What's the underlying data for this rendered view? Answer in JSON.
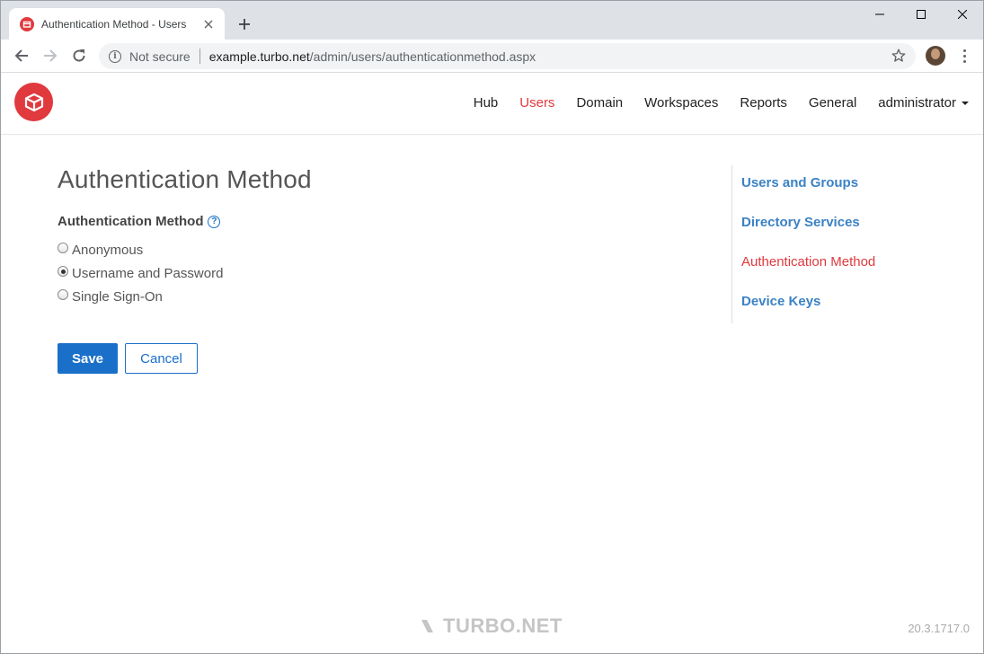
{
  "browser": {
    "tab_title": "Authentication Method - Users",
    "security_label": "Not secure",
    "url_domain": "example.turbo.net",
    "url_path": "/admin/users/authenticationmethod.aspx"
  },
  "site_nav": {
    "items": [
      {
        "label": "Hub",
        "active": false
      },
      {
        "label": "Users",
        "active": true
      },
      {
        "label": "Domain",
        "active": false
      },
      {
        "label": "Workspaces",
        "active": false
      },
      {
        "label": "Reports",
        "active": false
      },
      {
        "label": "General",
        "active": false
      }
    ],
    "user_menu": "administrator"
  },
  "main": {
    "title": "Authentication Method",
    "field_label": "Authentication Method",
    "options": [
      {
        "label": "Anonymous",
        "checked": false
      },
      {
        "label": "Username and Password",
        "checked": true
      },
      {
        "label": "Single Sign-On",
        "checked": false
      }
    ],
    "save_label": "Save",
    "cancel_label": "Cancel"
  },
  "side_nav": {
    "items": [
      {
        "label": "Users and Groups",
        "active": false
      },
      {
        "label": "Directory Services",
        "active": false
      },
      {
        "label": "Authentication Method",
        "active": true
      },
      {
        "label": "Device Keys",
        "active": false
      }
    ]
  },
  "footer": {
    "brand": "TURBO.NET",
    "version": "20.3.1717.0"
  },
  "colors": {
    "brand_red": "#e0393e",
    "link_blue": "#3b82c4",
    "button_blue": "#1a6fc9"
  }
}
